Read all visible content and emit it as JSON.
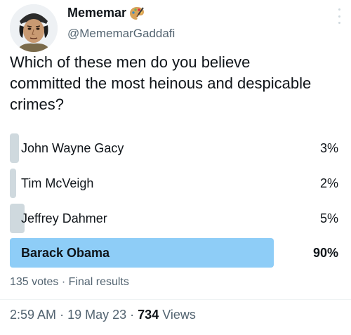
{
  "author": {
    "display_name": "Mememar",
    "handle": "@MememarGaddafi",
    "avatar_icon": "cartoon-portrait-avatar",
    "name_emoji": "artist-palette-icon"
  },
  "tweet": {
    "text": "Which of these men do you believe committed the most heinous and despicable crimes?"
  },
  "poll": {
    "options": [
      {
        "label": "John Wayne Gacy",
        "percent_text": "3%",
        "percent": 3,
        "winner": false
      },
      {
        "label": "Tim McVeigh",
        "percent_text": "2%",
        "percent": 2,
        "winner": false
      },
      {
        "label": "Jeffrey Dahmer",
        "percent_text": "5%",
        "percent": 5,
        "winner": false
      },
      {
        "label": "Barack Obama",
        "percent_text": "90%",
        "percent": 90,
        "winner": true
      }
    ],
    "votes": "135 votes",
    "separator": "·",
    "status": "Final results",
    "bar_color": "#cfd9de",
    "winner_bar_color": "#8ecdf7"
  },
  "meta": {
    "time": "2:59 AM",
    "date": "19 May 23",
    "views_count": "734",
    "views_label": "Views",
    "separator": "·"
  }
}
